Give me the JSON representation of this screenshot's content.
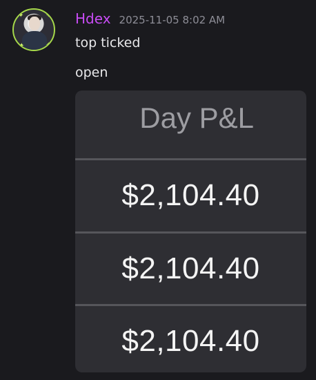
{
  "message": {
    "username": "Hdex",
    "timestamp": "2025-11-05 8:02 AM",
    "lines": [
      "top ticked",
      "open"
    ]
  },
  "embed": {
    "title": "Day P&L",
    "values": [
      "$2,104.40",
      "$2,104.40",
      "$2,104.40"
    ]
  },
  "colors": {
    "background": "#1a1a1e",
    "username": "#c84cf5",
    "timestamp": "#8e8e97",
    "text": "#e8e8ea",
    "embed_bg": "#2e2e33",
    "divider": "#56565b",
    "avatar_ring": "#a6d84a"
  },
  "icons": {
    "avatar": "user-avatar"
  }
}
